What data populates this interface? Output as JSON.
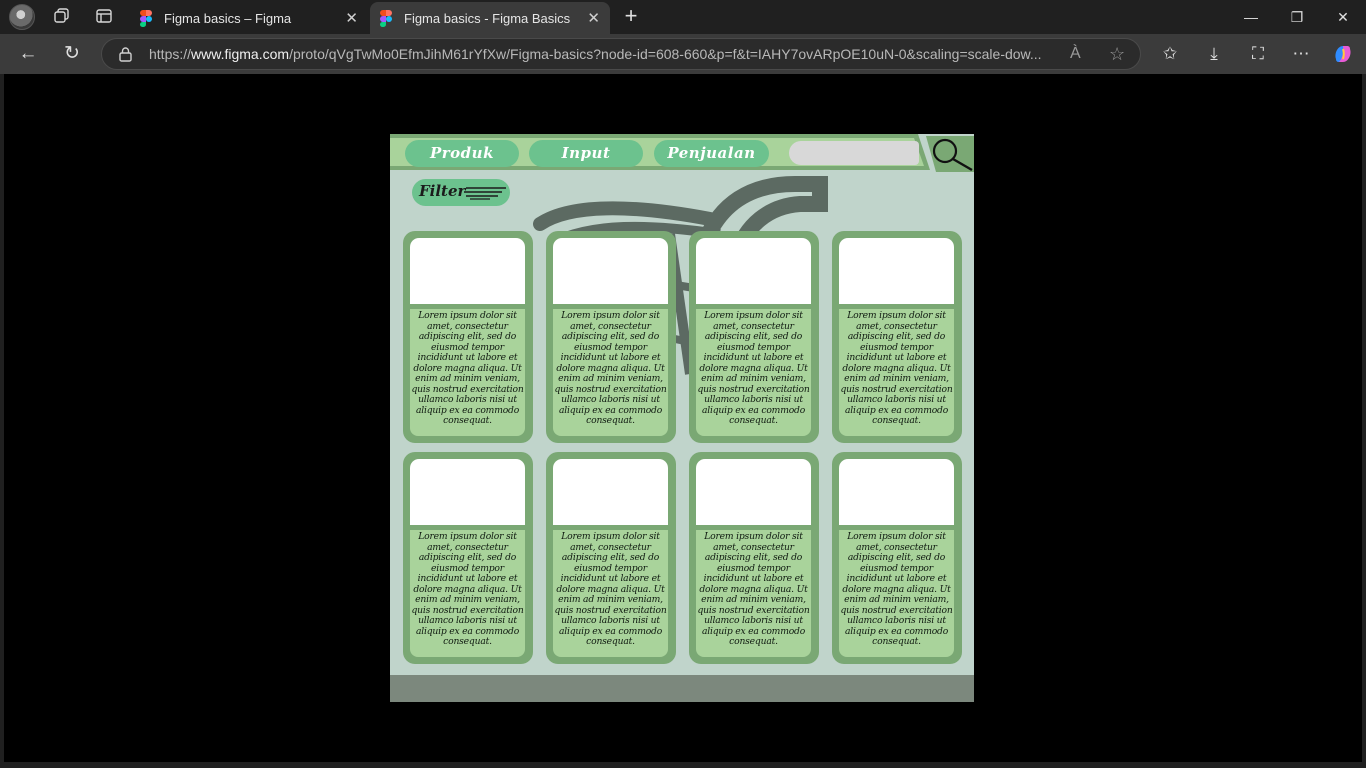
{
  "browser": {
    "tabs": [
      {
        "title": "Figma basics – Figma",
        "active": false
      },
      {
        "title": "Figma basics - Figma Basics",
        "active": true
      }
    ],
    "url_prefix": "https://",
    "url_domain": "www.figma.com",
    "url_rest": "/proto/qVgTwMo0EfmJihM61rYfXw/Figma-basics?node-id=608-660&p=f&t=IAHY7ovARpOE10uN-0&scaling=scale-dow...",
    "icons": {
      "back": "←",
      "refresh": "↻",
      "read_aloud": "À",
      "favorite": "☆",
      "favorites": "✩",
      "downloads": "⤓",
      "screenshot": "⛶",
      "more": "⋯",
      "minimize": "—",
      "restore": "❐",
      "close": "✕",
      "new_tab": "+",
      "tab_close": "✕"
    }
  },
  "app": {
    "nav": [
      {
        "label": "Produk"
      },
      {
        "label": "Input"
      },
      {
        "label": "Penjualan"
      }
    ],
    "filter_label": "Filter",
    "cards": [
      {
        "text": "Lorem ipsum dolor sit amet, consectetur adipiscing elit, sed do eiusmod tempor incididunt ut labore et dolore magna aliqua. Ut enim ad minim veniam, quis nostrud exercitation ullamco laboris nisi ut aliquip ex ea commodo consequat."
      },
      {
        "text": "Lorem ipsum dolor sit amet, consectetur adipiscing elit, sed do eiusmod tempor incididunt ut labore et dolore magna aliqua. Ut enim ad minim veniam, quis nostrud exercitation ullamco laboris nisi ut aliquip ex ea commodo consequat."
      },
      {
        "text": "Lorem ipsum dolor sit amet, consectetur adipiscing elit, sed do eiusmod tempor incididunt ut labore et dolore magna aliqua. Ut enim ad minim veniam, quis nostrud exercitation ullamco laboris nisi ut aliquip ex ea commodo consequat."
      },
      {
        "text": "Lorem ipsum dolor sit amet, consectetur adipiscing elit, sed do eiusmod tempor incididunt ut labore et dolore magna aliqua. Ut enim ad minim veniam, quis nostrud exercitation ullamco laboris nisi ut aliquip ex ea commodo consequat."
      },
      {
        "text": "Lorem ipsum dolor sit amet, consectetur adipiscing elit, sed do eiusmod tempor incididunt ut labore et dolore magna aliqua. Ut enim ad minim veniam, quis nostrud exercitation ullamco laboris nisi ut aliquip ex ea commodo consequat."
      },
      {
        "text": "Lorem ipsum dolor sit amet, consectetur adipiscing elit, sed do eiusmod tempor incididunt ut labore et dolore magna aliqua. Ut enim ad minim veniam, quis nostrud exercitation ullamco laboris nisi ut aliquip ex ea commodo consequat."
      },
      {
        "text": "Lorem ipsum dolor sit amet, consectetur adipiscing elit, sed do eiusmod tempor incididunt ut labore et dolore magna aliqua. Ut enim ad minim veniam, quis nostrud exercitation ullamco laboris nisi ut aliquip ex ea commodo consequat."
      },
      {
        "text": "Lorem ipsum dolor sit amet, consectetur adipiscing elit, sed do eiusmod tempor incididunt ut labore et dolore magna aliqua. Ut enim ad minim veniam, quis nostrud exercitation ullamco laboris nisi ut aliquip ex ea commodo consequat."
      }
    ],
    "colors": {
      "background": "#c0d4cb",
      "accent": "#6cc28e",
      "card_frame": "#7aa874",
      "card_text_bg": "#a9d39b",
      "footer": "#7c887d"
    }
  }
}
